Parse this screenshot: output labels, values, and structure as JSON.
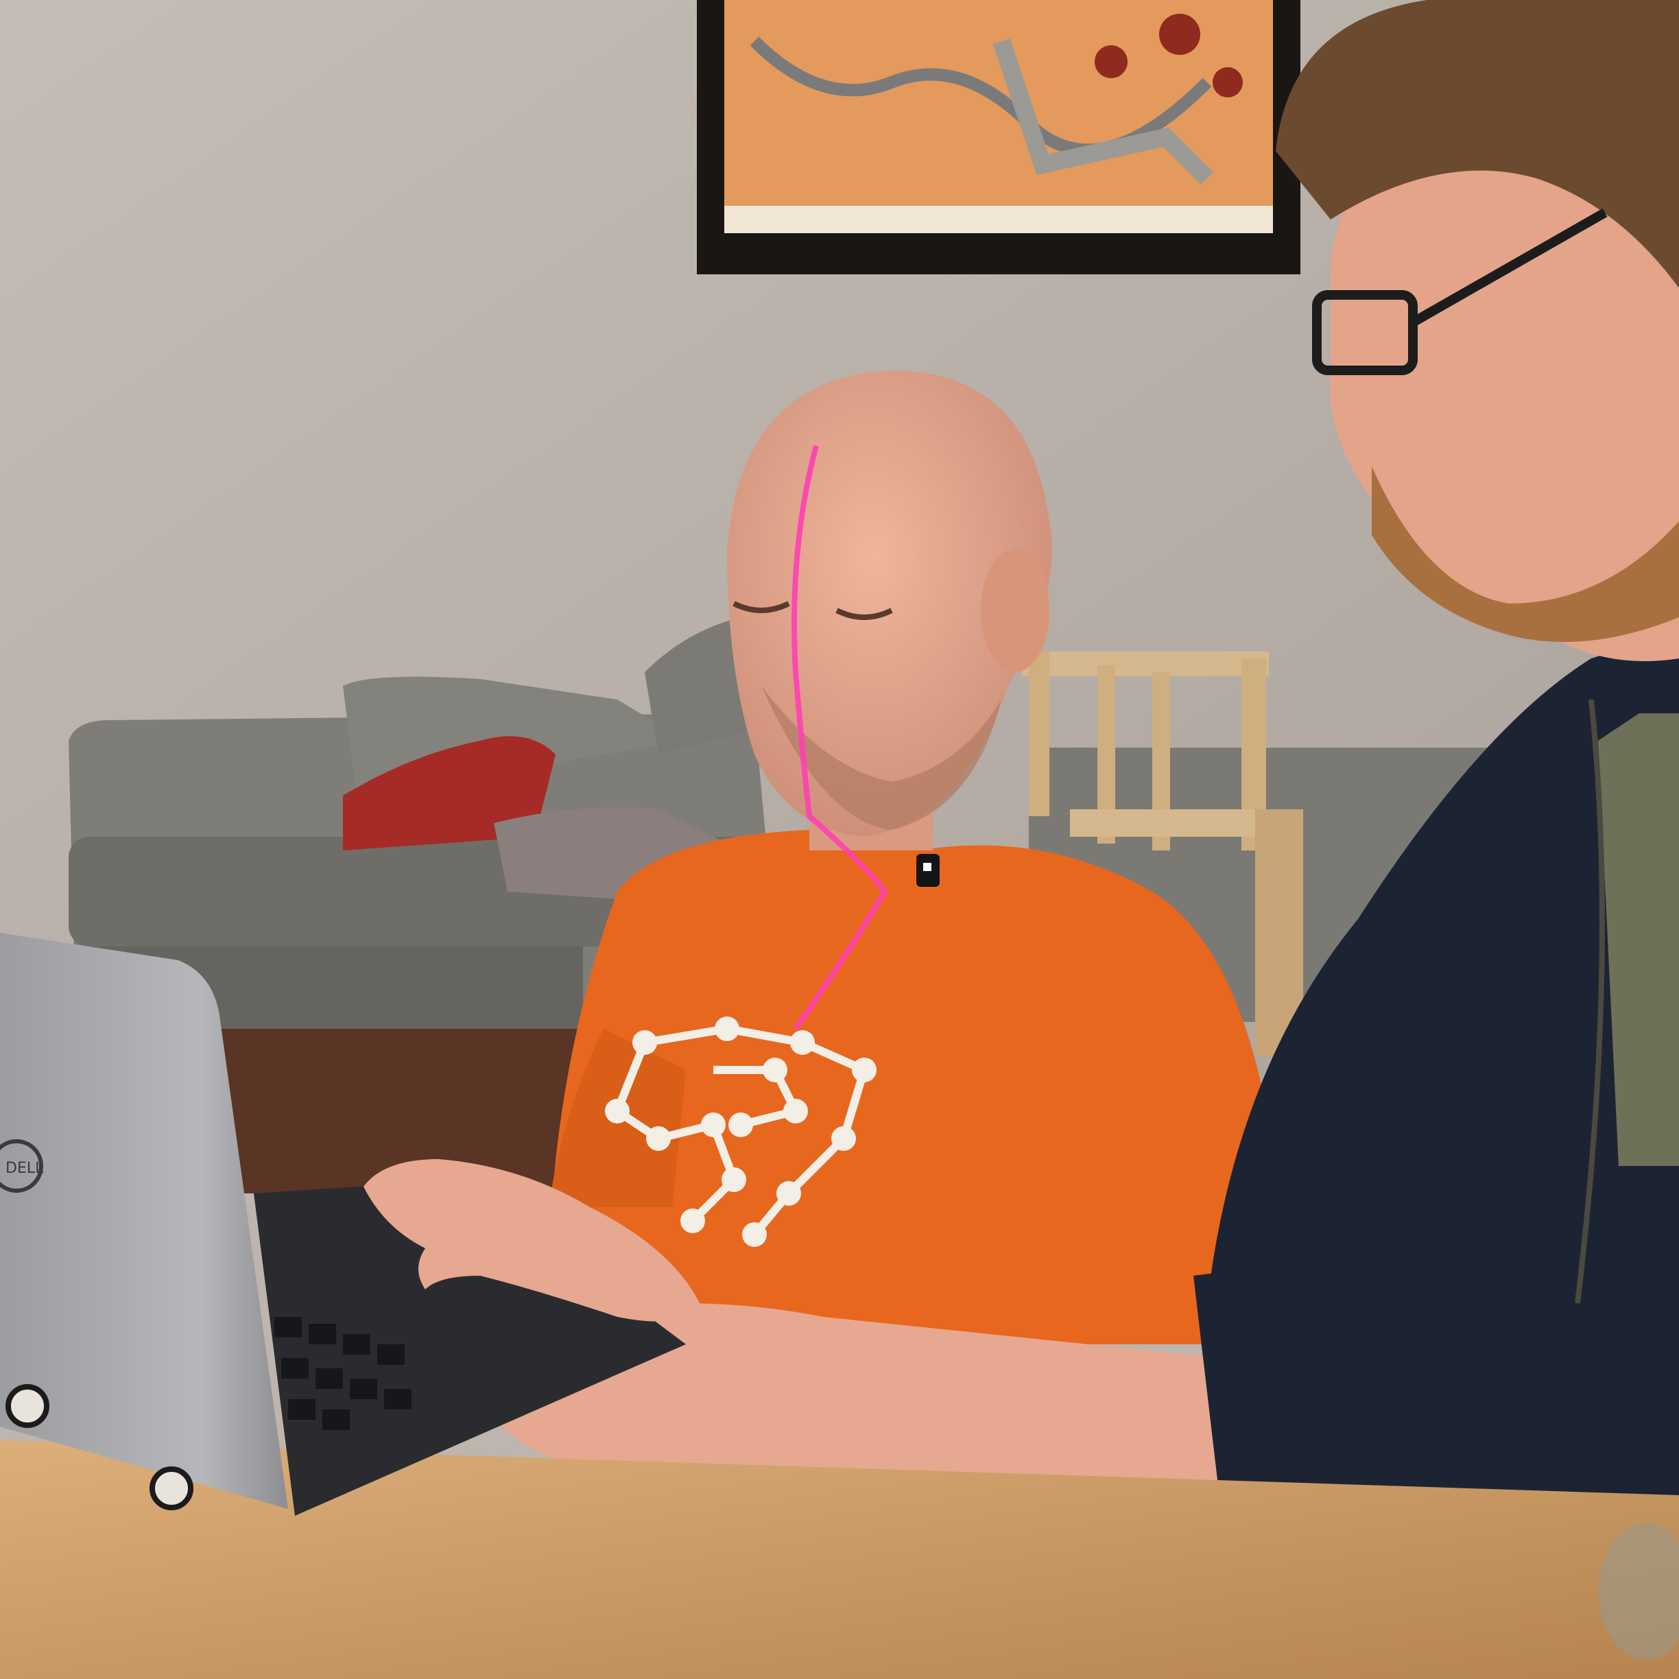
{
  "scene": {
    "kind": "photograph",
    "subjects": [
      "person-typing",
      "person-watching"
    ],
    "palette": {
      "wall": "#bcb4ad",
      "wall_shadow": "#a59d96",
      "sofa": "#7f7d78",
      "sofa_dark": "#66645f",
      "chair": "#d6b88e",
      "floor": "#5a3424",
      "table": "#c99a66",
      "table_light": "#dcae79",
      "shirt_orange": "#e8671e",
      "shirt_print": "#f4efe6",
      "skin": "#e6a890",
      "skin_shadow": "#c98a74",
      "cardigan": "#1c2433",
      "tshirt_olive": "#6f7058",
      "hair": "#6b4a30",
      "beard": "#a8703f",
      "laptop_silver": "#a5a6a8",
      "laptop_keys": "#1e1f22",
      "laser_line": "#ff3fb4",
      "frame": "#1a1614",
      "painting": "#e39a5c"
    },
    "logo": {
      "brand_text": "DELL",
      "icon": "dell-logo-icon"
    }
  }
}
